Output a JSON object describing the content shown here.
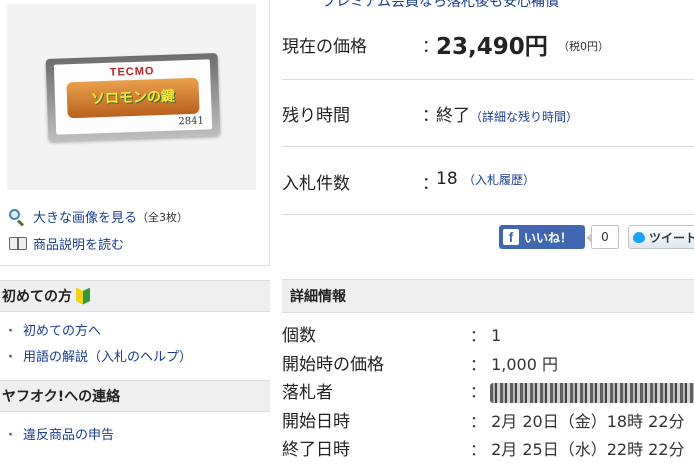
{
  "banner": "プレミアム会員なら落札後も安心補償",
  "image": {
    "cartridge_brand": "TECMO",
    "cartridge_title": "ソロモンの鍵",
    "cartridge_number": "2841"
  },
  "thumb_links": {
    "large_image": "大きな画像を見る",
    "large_image_count": "（全3枚）",
    "description": "商品説明を読む"
  },
  "sidebar": {
    "beginners_title": "初めての方",
    "beginners_items": [
      "初めての方へ",
      "用語の解説（入札のヘルプ）"
    ],
    "contact_title": "ヤフオク!への連絡",
    "contact_items": [
      "違反商品の申告"
    ]
  },
  "auction": {
    "price_label": "現在の価格",
    "price_value": "23,490円",
    "tax_note": "（税0円）",
    "time_label": "残り時間",
    "time_value": "終了",
    "time_link": "（詳細な残り時間）",
    "bids_label": "入札件数",
    "bids_value": "18",
    "bids_link": "（入札履歴）",
    "colon": "："
  },
  "social": {
    "like_label": "いいね！",
    "like_count": "0",
    "tweet_label": "ツイート"
  },
  "details": {
    "heading": "詳細情報",
    "rows": [
      {
        "label": "個数",
        "value": "1"
      },
      {
        "label": "開始時の価格",
        "value": "1,000 円"
      },
      {
        "label": "落札者",
        "value": ""
      },
      {
        "label": "開始日時",
        "value": "2月 20日（金）18時 22分"
      },
      {
        "label": "終了日時",
        "value": "2月 25日（水）22時 22分"
      }
    ]
  }
}
